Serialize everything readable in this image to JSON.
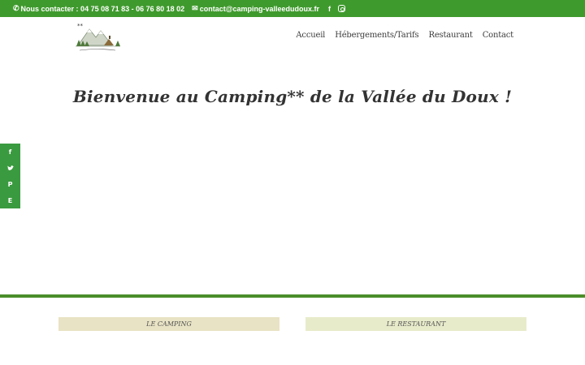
{
  "topbar": {
    "phone_label": "Nous contacter : 04 75 08 71 83 - 06 76 80 18 02",
    "email": "contact@camping-valleedudoux.fr",
    "phone_icon": "phone-icon",
    "email_icon": "envelope-icon",
    "social": [
      {
        "name": "facebook-icon",
        "glyph": "f"
      },
      {
        "name": "instagram-icon",
        "glyph": ""
      }
    ]
  },
  "header": {
    "logo_stars": "**",
    "nav": [
      {
        "label": "Accueil"
      },
      {
        "label": "Hébergements/Tarifs"
      },
      {
        "label": "Restaurant"
      },
      {
        "label": "Contact"
      }
    ]
  },
  "main": {
    "title": "Bienvenue au Camping** de la Vallée du Doux !"
  },
  "share": {
    "buttons": [
      {
        "name": "facebook-share-icon",
        "glyph": "f"
      },
      {
        "name": "twitter-share-icon",
        "glyph": "🐦"
      },
      {
        "name": "pinterest-share-icon",
        "glyph": "P"
      },
      {
        "name": "evernote-share-icon",
        "glyph": "E"
      }
    ]
  },
  "sections": {
    "left_label": "LE CAMPING",
    "right_label": "LE RESTAURANT"
  },
  "colors": {
    "accent_green": "#3f9a2d",
    "divider_green": "#4a8e2a",
    "panel_left": "#e8e3c4",
    "panel_right": "#e8ebca"
  }
}
